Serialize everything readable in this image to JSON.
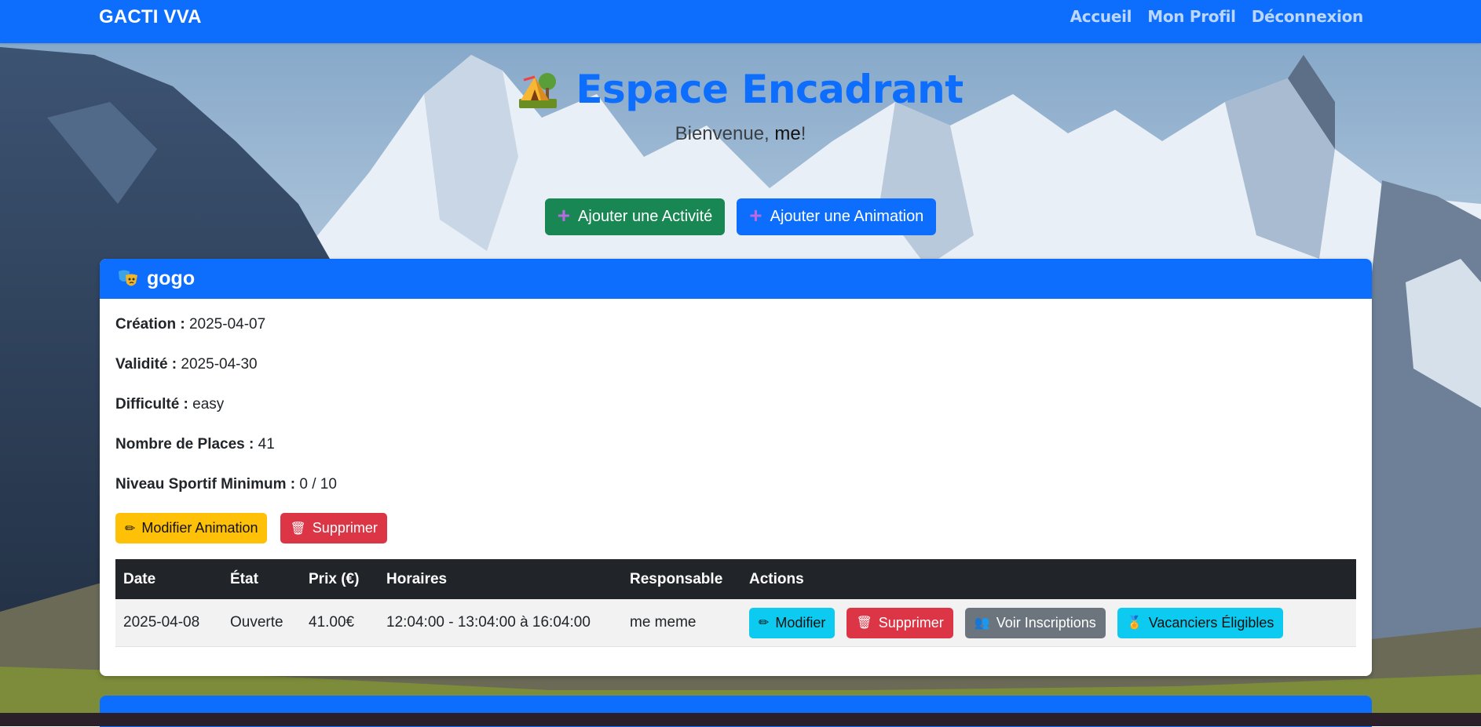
{
  "navbar": {
    "brand": "GACTI VVA",
    "links": [
      "Accueil",
      "Mon Profil",
      "Déconnexion"
    ]
  },
  "hero": {
    "icon": "camping-tent-icon",
    "title": "Espace Encadrant",
    "welcome_prefix": "Bienvenue,",
    "welcome_user": "me",
    "welcome_suffix": "!"
  },
  "actions": {
    "add_activity": "Ajouter une Activité",
    "add_animation": "Ajouter une Animation"
  },
  "animation": {
    "icon": "theater-masks-icon",
    "name": "gogo",
    "fields": {
      "creation_label": "Création :",
      "creation_value": "2025-04-07",
      "validity_label": "Validité :",
      "validity_value": "2025-04-30",
      "difficulty_label": "Difficulté :",
      "difficulty_value": "easy",
      "places_label": "Nombre de Places :",
      "places_value": "41",
      "level_label": "Niveau Sportif Minimum :",
      "level_value": "0 / 10"
    },
    "buttons": {
      "edit": "Modifier Animation",
      "delete": "Supprimer"
    },
    "table": {
      "headers": [
        "Date",
        "État",
        "Prix (€)",
        "Horaires",
        "Responsable",
        "Actions"
      ],
      "rows": [
        {
          "date": "2025-04-08",
          "state": "Ouverte",
          "price": "41.00€",
          "hours": "12:04:00 - 13:04:00 à 16:04:00",
          "manager": "me meme",
          "actions": {
            "edit": "Modifier",
            "delete": "Supprimer",
            "view": "Voir Inscriptions",
            "eligible": "Vacanciers Éligibles"
          }
        }
      ]
    }
  },
  "colors": {
    "primary": "#0d6efd",
    "success": "#198754",
    "warning": "#ffc107",
    "danger": "#dc3545",
    "info": "#0dcaf0",
    "secondary": "#6c757d",
    "dark": "#212529"
  }
}
